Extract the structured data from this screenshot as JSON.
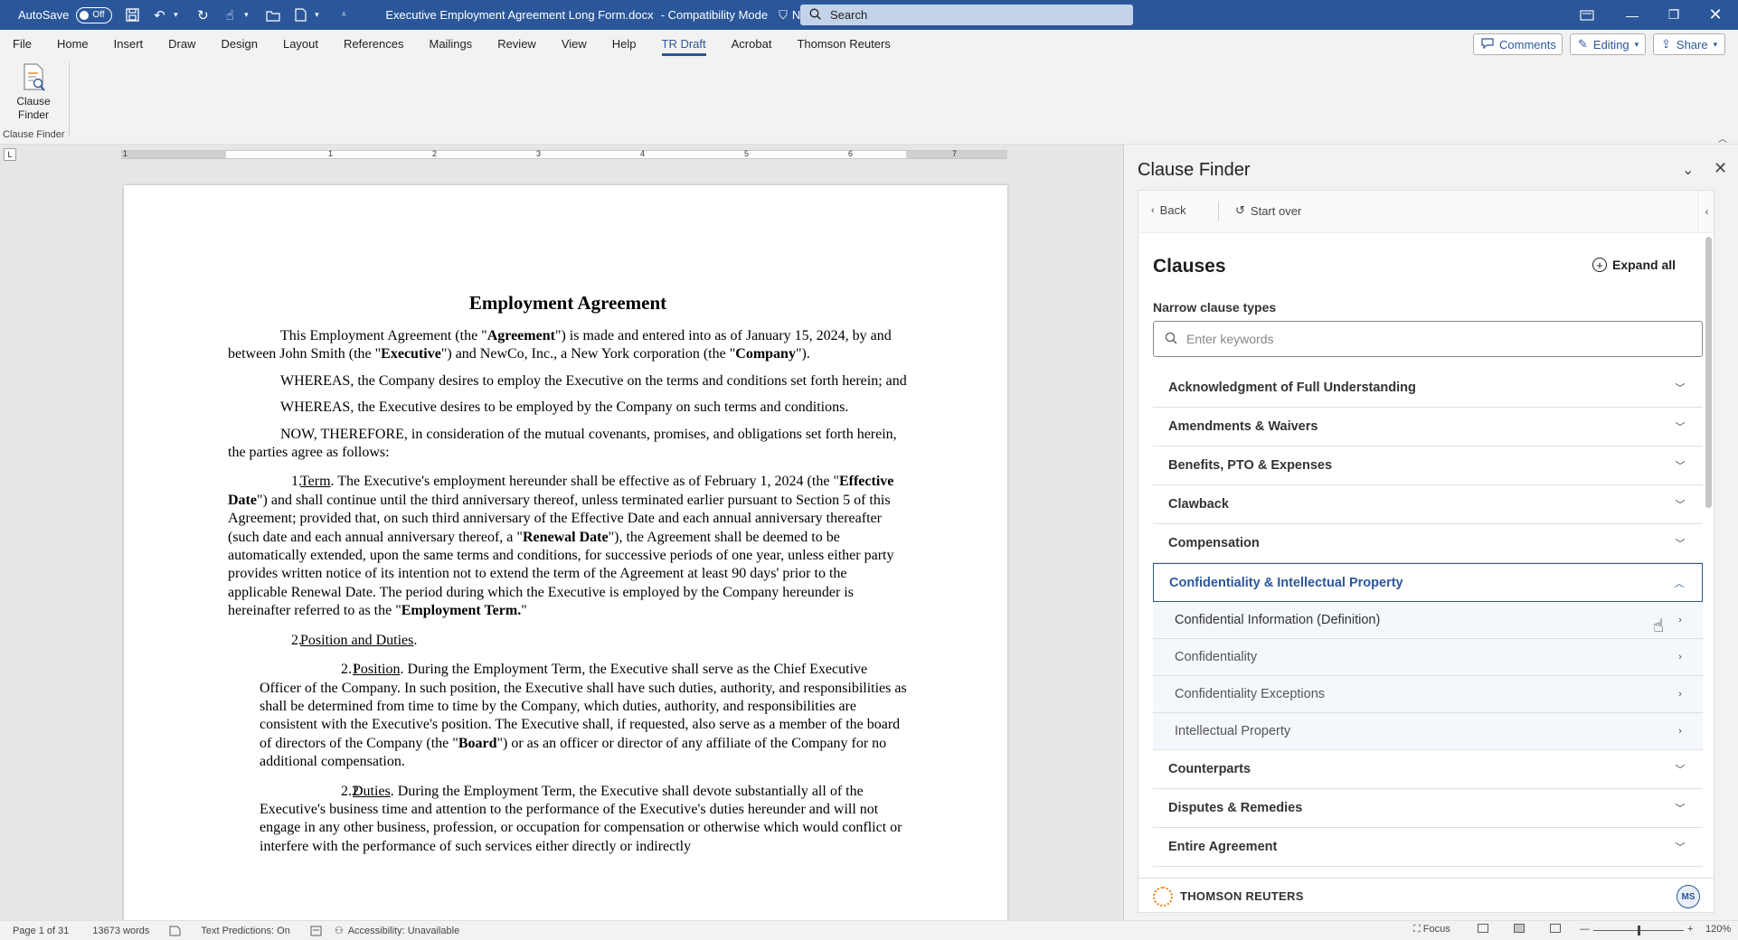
{
  "titlebar": {
    "autosave_label": "AutoSave",
    "autosave_state": "Off",
    "doc_title": "Executive Employment Agreement Long Form.docx",
    "mode": "-  Compatibility Mode",
    "label": "No Label",
    "search_placeholder": "Search"
  },
  "ribbon_tabs": [
    "File",
    "Home",
    "Insert",
    "Draw",
    "Design",
    "Layout",
    "References",
    "Mailings",
    "Review",
    "View",
    "Help",
    "TR Draft",
    "Acrobat",
    "Thomson Reuters"
  ],
  "active_tab": "TR Draft",
  "ribbon_buttons": {
    "comments": "Comments",
    "editing": "Editing",
    "share": "Share"
  },
  "ribbon": {
    "clause_finder_line1": "Clause",
    "clause_finder_line2": "Finder",
    "group_label": "Clause Finder"
  },
  "ruler": {
    "tab_selector": "L",
    "numbers": [
      "1",
      "1",
      "2",
      "3",
      "4",
      "5",
      "6",
      "7"
    ]
  },
  "document": {
    "title": "Employment Agreement",
    "p1_a": "This Employment Agreement (the \"",
    "p1_b": "Agreement",
    "p1_c": "\") is made and entered into as of January 15, 2024, by and between John Smith (the \"",
    "p1_d": "Executive",
    "p1_e": "\") and NewCo, Inc., a New York corporation (the \"",
    "p1_f": "Company",
    "p1_g": "\").",
    "p2": "WHEREAS, the Company desires to employ the Executive on the terms and conditions set forth herein; and",
    "p3": "WHEREAS, the Executive desires to be employed by the Company on such terms and conditions.",
    "p4": "NOW, THEREFORE, in consideration of the mutual covenants, promises, and obligations set forth herein, the parties agree as follows:",
    "s1_num": "1.",
    "s1_head": "Term",
    "s1_a": ". The Executive's employment hereunder shall be effective as of February 1, 2024 (the \"",
    "s1_b": "Effective Date",
    "s1_c": "\") and shall continue until the third anniversary thereof, unless terminated earlier pursuant to Section 5 of this Agreement; provided that, on such third anniversary of the Effective Date and each annual anniversary thereafter (such date and each annual anniversary thereof, a \"",
    "s1_d": "Renewal Date",
    "s1_e": "\"), the Agreement shall be deemed to be automatically extended, upon the same terms and conditions, for successive periods of one year, unless either party provides written notice of its intention not to extend the term of the Agreement at least 90 days' prior to the applicable Renewal Date. The period during which the Executive is employed by the Company hereunder is hereinafter referred to as the \"",
    "s1_f": "Employment Term.",
    "s1_g": "\"",
    "s2_num": "2.",
    "s2_head": "Position and Duties",
    "s2_dot": ".",
    "s21_num": "2.1",
    "s21_head": "Position",
    "s21_a": ". During the Employment Term, the Executive shall serve as the Chief Executive Officer of the Company. In such position, the Executive shall have such duties, authority, and responsibilities as shall be determined from time to time by the Company, which duties, authority, and responsibilities are consistent with the Executive's position. The Executive shall, if requested, also serve as a member of the board of directors of the Company (the \"",
    "s21_b": "Board",
    "s21_c": "\") or as an officer or director of any affiliate of the Company for no additional compensation.",
    "s22_num": "2.2",
    "s22_head": "Duties",
    "s22_a": ". During the Employment Term, the Executive shall devote substantially all of the Executive's business time and attention to the performance of the Executive's duties hereunder and will not engage in any other business, profession, or occupation for compensation or otherwise which would conflict or interfere with the performance of such services either directly or indirectly"
  },
  "pane": {
    "title": "Clause Finder",
    "back": "Back",
    "start_over": "Start over",
    "heading": "Clauses",
    "expand_all": "Expand all",
    "narrow_label": "Narrow clause types",
    "search_placeholder": "Enter keywords",
    "categories_before": [
      "Acknowledgment of Full Understanding",
      "Amendments & Waivers",
      "Benefits, PTO & Expenses",
      "Clawback",
      "Compensation"
    ],
    "open_category": "Confidentiality & Intellectual Property",
    "sub_items": [
      "Confidential Information (Definition)",
      "Confidentiality",
      "Confidentiality Exceptions",
      "Intellectual Property"
    ],
    "categories_after": [
      "Counterparts",
      "Disputes & Remedies",
      "Entire Agreement"
    ],
    "footer_brand": "THOMSON REUTERS",
    "avatar": "MS"
  },
  "statusbar": {
    "page": "Page 1 of 31",
    "words": "13673 words",
    "text_predictions": "Text Predictions: On",
    "accessibility": "Accessibility: Unavailable",
    "focus": "Focus",
    "zoom": "120%"
  },
  "colors": {
    "word_blue": "#2b579a",
    "tr_orange": "#f07d00"
  }
}
